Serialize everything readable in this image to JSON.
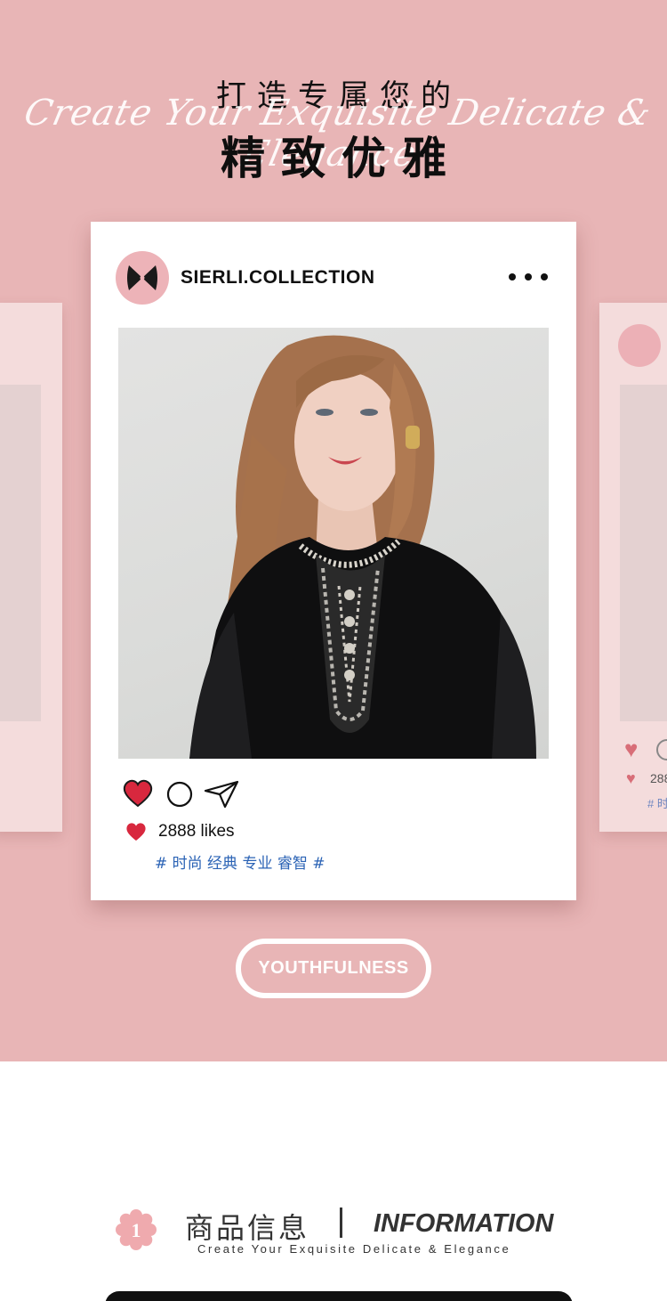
{
  "header": {
    "title_top": "打造专属您的",
    "script_line": "Create Your Exquisite Delicate & Elegance",
    "title_main": "精致优雅"
  },
  "post": {
    "username": "SIERLI.COLLECTION",
    "likes_text": "2888 likes",
    "hashtags": "# 时尚 经典 专业 睿智 #",
    "liked": true,
    "icons": [
      "heart-icon",
      "comment-icon",
      "share-icon",
      "more-icon"
    ]
  },
  "side_card_right": {
    "likes_text": "288",
    "hashtag": "# 时"
  },
  "cta": {
    "label": "YOUTHFULNESS"
  },
  "info": {
    "badge_number": "1",
    "title_cn": "商品信息",
    "title_en": "INFORMATION",
    "subtitle": "Create Your Exquisite Delicate & Elegance"
  },
  "colors": {
    "background_pink": "#e8b5b6",
    "card_white": "#ffffff",
    "heart_red": "#d8283e",
    "hashtag_blue": "#2b63b5",
    "badge_pink": "#efaaae"
  }
}
